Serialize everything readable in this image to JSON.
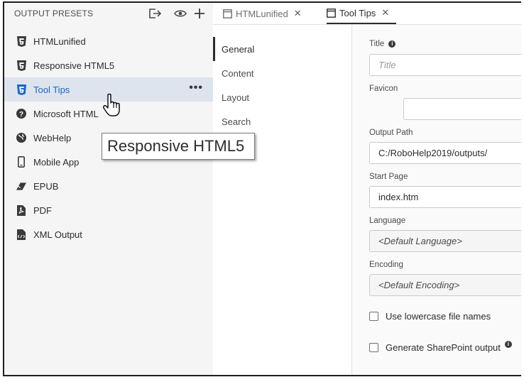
{
  "left_panel": {
    "title": "OUTPUT PRESETS",
    "header_icons": [
      "export-icon",
      "eye-icon",
      "plus-icon"
    ],
    "items": [
      {
        "label": "HTMLunified",
        "icon": "html5-icon"
      },
      {
        "label": "Responsive HTML5",
        "icon": "html5-icon"
      },
      {
        "label": "Tool Tips",
        "icon": "html5-icon",
        "selected": true
      },
      {
        "label": "Microsoft HTML",
        "icon": "question-circle-icon"
      },
      {
        "label": "WebHelp",
        "icon": "globe-icon"
      },
      {
        "label": "Mobile App",
        "icon": "mobile-icon"
      },
      {
        "label": "EPUB",
        "icon": "eraser-icon"
      },
      {
        "label": "PDF",
        "icon": "pdf-icon"
      },
      {
        "label": "XML Output",
        "icon": "xml-file-icon"
      }
    ],
    "more_label": "•••"
  },
  "tabs": [
    {
      "label": "HTMLunified",
      "close": "✕",
      "active": false
    },
    {
      "label": "Tool Tips",
      "close": "✕",
      "active": true
    }
  ],
  "settings_nav": [
    "General",
    "Content",
    "Layout",
    "Search"
  ],
  "form": {
    "title_label": "Title",
    "title_placeholder": "Title",
    "favicon_label": "Favicon",
    "output_path_label": "Output Path",
    "output_path_value": "C:/RoboHelp2019/outputs/",
    "start_page_label": "Start Page",
    "start_page_value": "index.htm",
    "language_label": "Language",
    "language_value": "<Default Language>",
    "encoding_label": "Encoding",
    "encoding_value": "<Default Encoding>",
    "lowercase_label": "Use lowercase file names",
    "sharepoint_label": "Generate SharePoint output"
  },
  "tooltip": {
    "text": "Responsive HTML5"
  },
  "colors": {
    "selected_bg": "#dde4ee",
    "selected_text": "#1c65c4"
  }
}
